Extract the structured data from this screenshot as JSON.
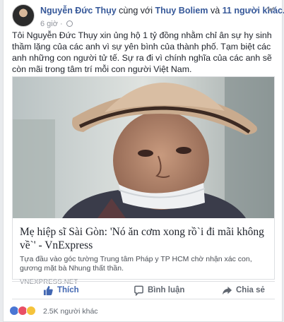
{
  "post": {
    "author": "Nguyễn Đức Thụy",
    "with_text": "cùng với",
    "tagged_person": "Thuy Boliem",
    "and_text": "và",
    "others": "11 người khác.",
    "time": "6 giờ ·",
    "text": "Tôi Nguyễn Đức Thụy xin ủng hộ 1 tỷ đồng nhằm chỉ ân sự hy sinh thầm lặng của các anh vì sự yên bình của thành phố. Tạm biệt các anh những con người tử tế. Sự ra đi vì chính nghĩa của các anh sẽ còn mãi trong tâm trí mỗi con người Việt Nam.",
    "menu_icon": "chevron-down-icon",
    "privacy_icon": "globe-icon"
  },
  "link": {
    "title": "Mẹ hiệp sĩ Sài Gòn: 'Nó ăn cơm xong rồ`i đi mãi không về`' - VnExpress",
    "description": "Tựa đầu vào góc tường Trung tâm Pháp y TP HCM chờ nhận xác con, gương mặt bà Nhung thất thần.",
    "domain": "VNEXPRESS.NET"
  },
  "actions": {
    "like": "Thích",
    "comment": "Bình luận",
    "share": "Chia sẻ"
  },
  "reactions": {
    "count": "2.5K người khác",
    "icons": [
      "like-icon",
      "love-icon",
      "wow-icon"
    ]
  },
  "colors": {
    "link_blue": "#365899",
    "like_blue": "#4267b2",
    "muted": "#90949c",
    "background": "#e9ebee"
  }
}
